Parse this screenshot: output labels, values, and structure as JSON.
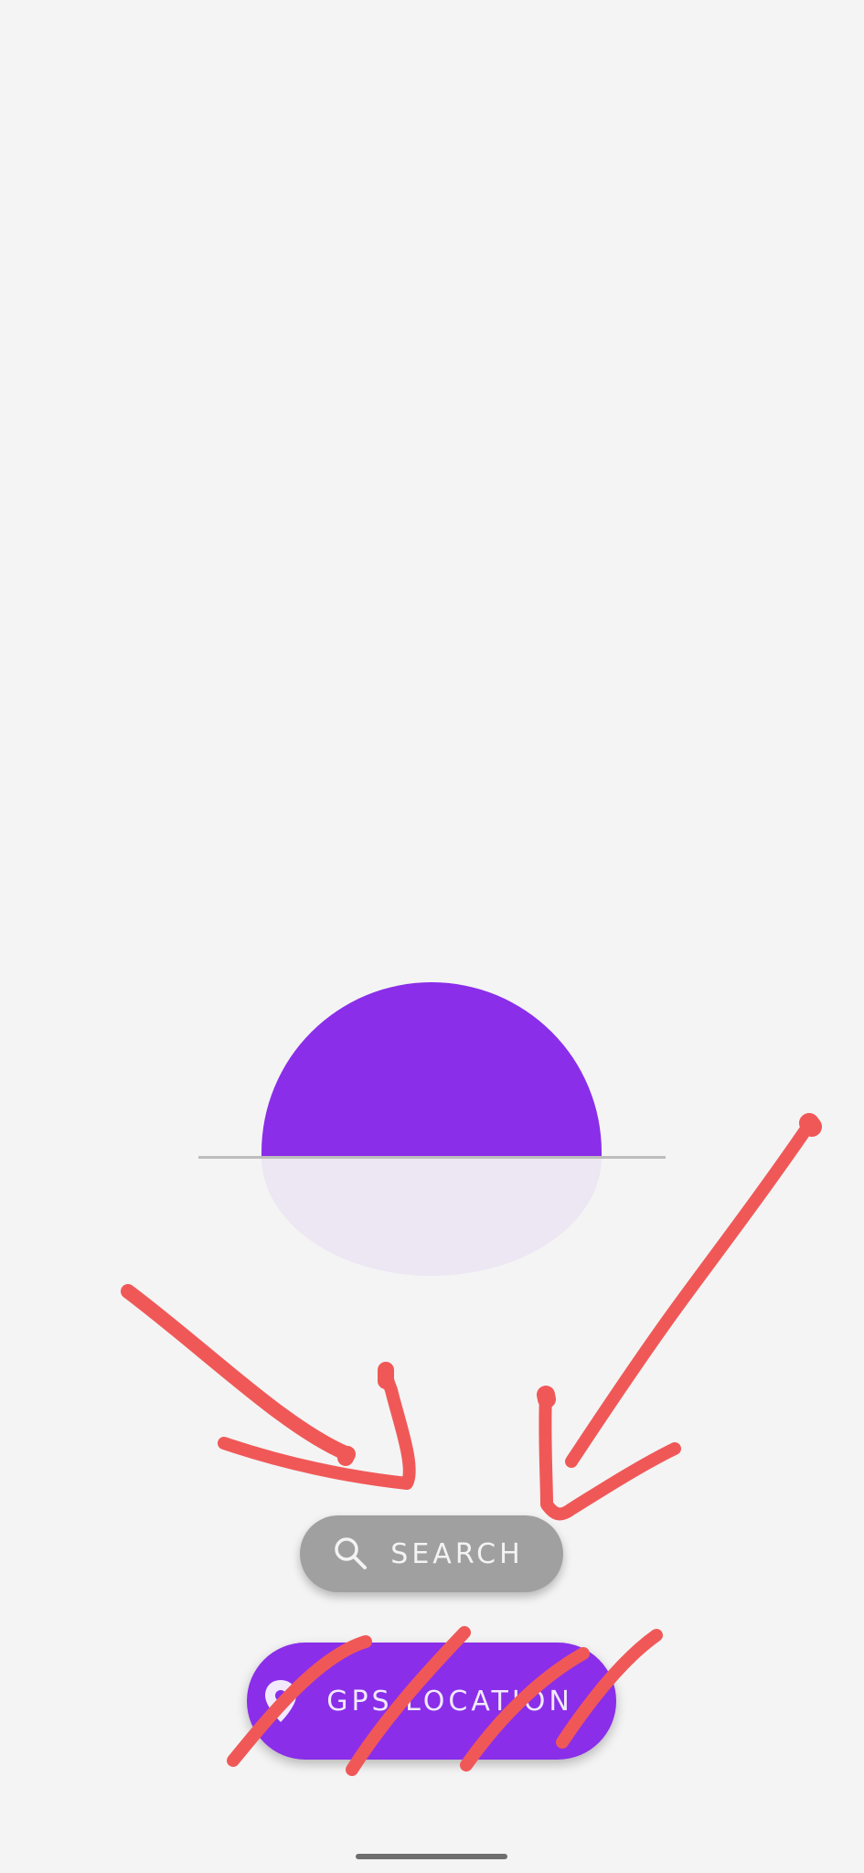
{
  "colors": {
    "background": "#f4f4f4",
    "accent": "#8a2ee9",
    "reflection": "#ece7f2",
    "search_button": "#a0a0a0",
    "annotation_stroke": "#f05858"
  },
  "search_button": {
    "label": "SEARCH",
    "icon": "search-icon"
  },
  "gps_button": {
    "label": "GPS LOCATION",
    "icon": "location-pin-icon"
  }
}
